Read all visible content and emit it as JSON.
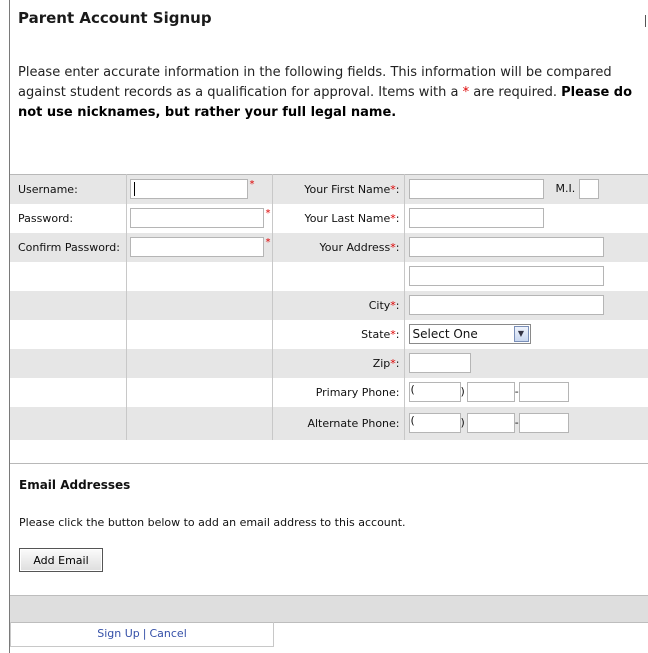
{
  "header": {
    "title": "Parent Account Signup"
  },
  "intro": {
    "text": "Please enter accurate information in the following fields.  This information will be compared against student records as a qualification for approval.  Items with a ",
    "asterisk": "*",
    "text2": " are required.  ",
    "bold": "Please do not use nicknames, but rather your full legal name."
  },
  "form": {
    "username_label": "Username:",
    "password_label": "Password:",
    "confirm_label": "Confirm Password:",
    "first_name_label": "Your First Name",
    "last_name_label": "Your Last Name",
    "address_label": "Your Address",
    "city_label": "City",
    "state_label": "State",
    "zip_label": "Zip",
    "primary_phone_label": "Primary Phone:",
    "alternate_phone_label": "Alternate Phone:",
    "mi_label": "M.I.",
    "state_selected": "Select One",
    "required_mark": "*",
    "colon": ":",
    "open_paren": "(",
    "close_paren": ")",
    "dash": "-"
  },
  "email": {
    "heading": "Email Addresses",
    "instructions": "Please click the button below to add an email address to this account.",
    "add_button": "Add Email"
  },
  "footer": {
    "signup": "Sign Up",
    "separator": "|",
    "cancel": "Cancel"
  }
}
